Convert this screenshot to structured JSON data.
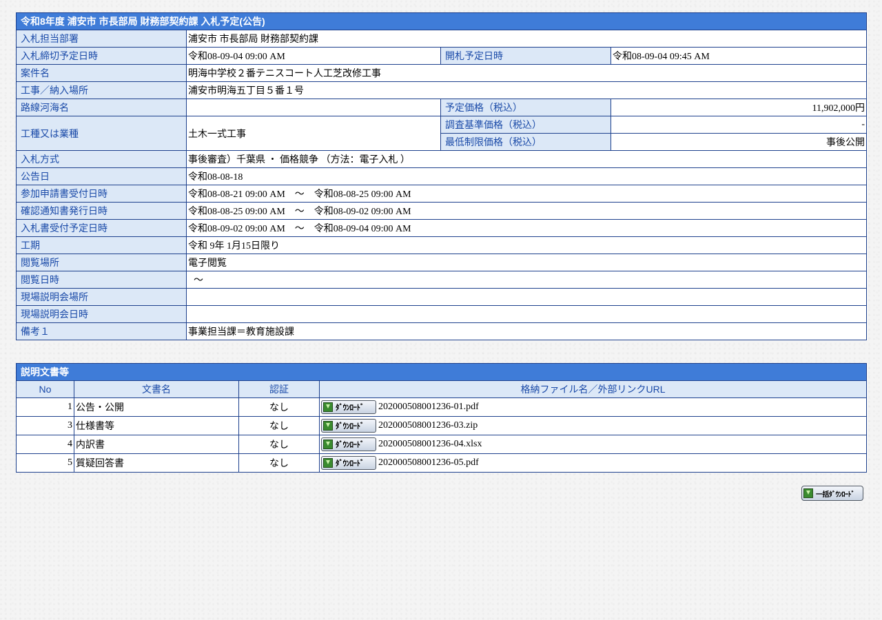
{
  "title": "令和8年度 浦安市 市長部局 財務部契約課 入札予定(公告)",
  "labels": {
    "dept": "入札担当部署",
    "deadline": "入札締切予定日時",
    "opening": "開札予定日時",
    "case_name": "案件名",
    "location": "工事／納入場所",
    "route": "路線河海名",
    "planned_price": "予定価格（税込）",
    "work_type": "工種又は業種",
    "survey_price": "調査基準価格（税込）",
    "min_price": "最低制限価格（税込）",
    "bid_method": "入札方式",
    "announce_date": "公告日",
    "apply_period": "参加申請書受付日時",
    "confirm_period": "確認通知書発行日時",
    "bid_receipt_period": "入札書受付予定日時",
    "term": "工期",
    "view_place": "閲覧場所",
    "view_datetime": "閲覧日時",
    "site_place": "現場説明会場所",
    "site_datetime": "現場説明会日時",
    "remarks": "備考１"
  },
  "values": {
    "dept": "浦安市 市長部局 財務部契約課",
    "deadline": "令和08-09-04 09:00 AM",
    "opening": "令和08-09-04 09:45 AM",
    "case_name": "明海中学校２番テニスコート人工芝改修工事",
    "location": "浦安市明海五丁目５番１号",
    "route": "",
    "planned_price": "11,902,000円",
    "work_type": "土木一式工事",
    "survey_price": "-",
    "min_price": "事後公開",
    "bid_method": "事後審査）千葉県 ・ 価格競争 （方法：電子入札 ）",
    "announce_date": "令和08-08-18",
    "apply_period": "令和08-08-21 09:00 AM　～　令和08-08-25 09:00 AM",
    "confirm_period": "令和08-08-25 09:00 AM　～　令和08-09-02 09:00 AM",
    "bid_receipt_period": "令和08-09-02 09:00 AM　～　令和08-09-04 09:00 AM",
    "term": "令和 9年 1月15日限り",
    "view_place": "電子閲覧",
    "view_datetime": "～",
    "site_place": "",
    "site_datetime": "",
    "remarks": "事業担当課＝教育施設課"
  },
  "docs": {
    "title": "説明文書等",
    "columns": [
      "No",
      "文書名",
      "認証",
      "格納ファイル名／外部リンクURL"
    ],
    "button_label": "ﾀﾞｳﾝﾛｰﾄﾞ",
    "rows": [
      {
        "no": "1",
        "name": "公告・公開",
        "auth": "なし",
        "file": "202000508001236-01.pdf"
      },
      {
        "no": "3",
        "name": "仕様書等",
        "auth": "なし",
        "file": "202000508001236-03.zip"
      },
      {
        "no": "4",
        "name": "内訳書",
        "auth": "なし",
        "file": "202000508001236-04.xlsx"
      },
      {
        "no": "5",
        "name": "質疑回答書",
        "auth": "なし",
        "file": "202000508001236-05.pdf"
      }
    ]
  },
  "bulk_button_label": "一括ﾀﾞｳﾝﾛｰﾄﾞ"
}
